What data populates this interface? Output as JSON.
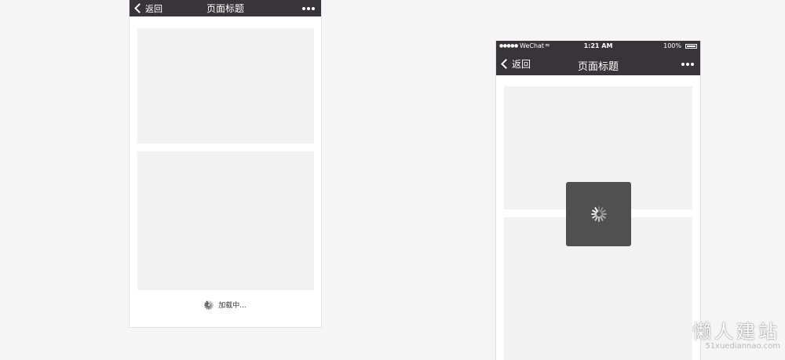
{
  "left_phone": {
    "navbar": {
      "back_label": "返回",
      "title": "页面标题"
    },
    "loading_text": "加载中..."
  },
  "right_phone": {
    "status_bar": {
      "signal": "●●●●●",
      "carrier": "WeChat",
      "wifi": "≈",
      "time": "1:21 AM",
      "battery": "100%"
    },
    "navbar": {
      "back_label": "返回",
      "title": "页面标题"
    }
  },
  "watermark": {
    "title": "懒人建站",
    "url": "51xuediannao.com"
  },
  "colors": {
    "navbar": "#37353a",
    "background": "#f5f5f5",
    "card": "#f2f2f2",
    "toast": "#505050"
  },
  "icons": {
    "back": "chevron-left-icon",
    "more": "ellipsis-icon",
    "spinner": "loading-spinner-icon"
  }
}
